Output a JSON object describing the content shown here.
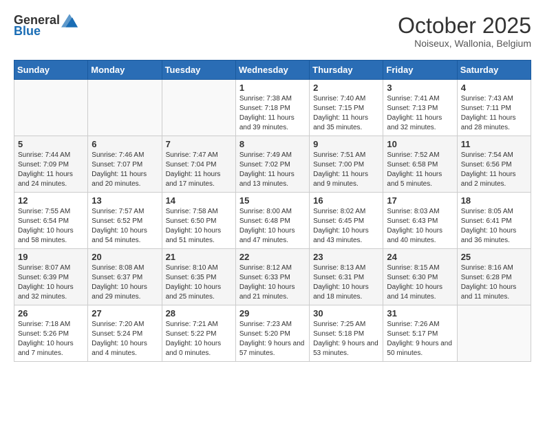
{
  "header": {
    "logo_general": "General",
    "logo_blue": "Blue",
    "month_title": "October 2025",
    "location": "Noiseux, Wallonia, Belgium"
  },
  "weekdays": [
    "Sunday",
    "Monday",
    "Tuesday",
    "Wednesday",
    "Thursday",
    "Friday",
    "Saturday"
  ],
  "weeks": [
    [
      {
        "day": "",
        "content": ""
      },
      {
        "day": "",
        "content": ""
      },
      {
        "day": "",
        "content": ""
      },
      {
        "day": "1",
        "content": "Sunrise: 7:38 AM\nSunset: 7:18 PM\nDaylight: 11 hours and 39 minutes."
      },
      {
        "day": "2",
        "content": "Sunrise: 7:40 AM\nSunset: 7:15 PM\nDaylight: 11 hours and 35 minutes."
      },
      {
        "day": "3",
        "content": "Sunrise: 7:41 AM\nSunset: 7:13 PM\nDaylight: 11 hours and 32 minutes."
      },
      {
        "day": "4",
        "content": "Sunrise: 7:43 AM\nSunset: 7:11 PM\nDaylight: 11 hours and 28 minutes."
      }
    ],
    [
      {
        "day": "5",
        "content": "Sunrise: 7:44 AM\nSunset: 7:09 PM\nDaylight: 11 hours and 24 minutes."
      },
      {
        "day": "6",
        "content": "Sunrise: 7:46 AM\nSunset: 7:07 PM\nDaylight: 11 hours and 20 minutes."
      },
      {
        "day": "7",
        "content": "Sunrise: 7:47 AM\nSunset: 7:04 PM\nDaylight: 11 hours and 17 minutes."
      },
      {
        "day": "8",
        "content": "Sunrise: 7:49 AM\nSunset: 7:02 PM\nDaylight: 11 hours and 13 minutes."
      },
      {
        "day": "9",
        "content": "Sunrise: 7:51 AM\nSunset: 7:00 PM\nDaylight: 11 hours and 9 minutes."
      },
      {
        "day": "10",
        "content": "Sunrise: 7:52 AM\nSunset: 6:58 PM\nDaylight: 11 hours and 5 minutes."
      },
      {
        "day": "11",
        "content": "Sunrise: 7:54 AM\nSunset: 6:56 PM\nDaylight: 11 hours and 2 minutes."
      }
    ],
    [
      {
        "day": "12",
        "content": "Sunrise: 7:55 AM\nSunset: 6:54 PM\nDaylight: 10 hours and 58 minutes."
      },
      {
        "day": "13",
        "content": "Sunrise: 7:57 AM\nSunset: 6:52 PM\nDaylight: 10 hours and 54 minutes."
      },
      {
        "day": "14",
        "content": "Sunrise: 7:58 AM\nSunset: 6:50 PM\nDaylight: 10 hours and 51 minutes."
      },
      {
        "day": "15",
        "content": "Sunrise: 8:00 AM\nSunset: 6:48 PM\nDaylight: 10 hours and 47 minutes."
      },
      {
        "day": "16",
        "content": "Sunrise: 8:02 AM\nSunset: 6:45 PM\nDaylight: 10 hours and 43 minutes."
      },
      {
        "day": "17",
        "content": "Sunrise: 8:03 AM\nSunset: 6:43 PM\nDaylight: 10 hours and 40 minutes."
      },
      {
        "day": "18",
        "content": "Sunrise: 8:05 AM\nSunset: 6:41 PM\nDaylight: 10 hours and 36 minutes."
      }
    ],
    [
      {
        "day": "19",
        "content": "Sunrise: 8:07 AM\nSunset: 6:39 PM\nDaylight: 10 hours and 32 minutes."
      },
      {
        "day": "20",
        "content": "Sunrise: 8:08 AM\nSunset: 6:37 PM\nDaylight: 10 hours and 29 minutes."
      },
      {
        "day": "21",
        "content": "Sunrise: 8:10 AM\nSunset: 6:35 PM\nDaylight: 10 hours and 25 minutes."
      },
      {
        "day": "22",
        "content": "Sunrise: 8:12 AM\nSunset: 6:33 PM\nDaylight: 10 hours and 21 minutes."
      },
      {
        "day": "23",
        "content": "Sunrise: 8:13 AM\nSunset: 6:31 PM\nDaylight: 10 hours and 18 minutes."
      },
      {
        "day": "24",
        "content": "Sunrise: 8:15 AM\nSunset: 6:30 PM\nDaylight: 10 hours and 14 minutes."
      },
      {
        "day": "25",
        "content": "Sunrise: 8:16 AM\nSunset: 6:28 PM\nDaylight: 10 hours and 11 minutes."
      }
    ],
    [
      {
        "day": "26",
        "content": "Sunrise: 7:18 AM\nSunset: 5:26 PM\nDaylight: 10 hours and 7 minutes."
      },
      {
        "day": "27",
        "content": "Sunrise: 7:20 AM\nSunset: 5:24 PM\nDaylight: 10 hours and 4 minutes."
      },
      {
        "day": "28",
        "content": "Sunrise: 7:21 AM\nSunset: 5:22 PM\nDaylight: 10 hours and 0 minutes."
      },
      {
        "day": "29",
        "content": "Sunrise: 7:23 AM\nSunset: 5:20 PM\nDaylight: 9 hours and 57 minutes."
      },
      {
        "day": "30",
        "content": "Sunrise: 7:25 AM\nSunset: 5:18 PM\nDaylight: 9 hours and 53 minutes."
      },
      {
        "day": "31",
        "content": "Sunrise: 7:26 AM\nSunset: 5:17 PM\nDaylight: 9 hours and 50 minutes."
      },
      {
        "day": "",
        "content": ""
      }
    ]
  ]
}
